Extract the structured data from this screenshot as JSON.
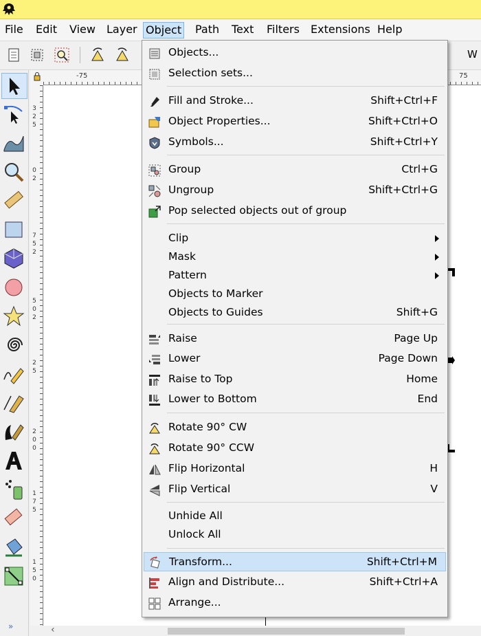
{
  "menubar": {
    "items": [
      "File",
      "Edit",
      "View",
      "Layer",
      "Object",
      "Path",
      "Text",
      "Filters",
      "Extensions",
      "Help"
    ],
    "active": "Object"
  },
  "toolbar": {
    "trailing_label": "W"
  },
  "rulers": {
    "top_labels": [
      "-75",
      "75"
    ],
    "left_labels": [
      "3",
      "2",
      "5",
      "0",
      "2",
      "7",
      "5",
      "2",
      "5",
      "0",
      "2",
      "2",
      "5",
      "2",
      "0",
      "0",
      "1",
      "7",
      "5",
      "1",
      "5",
      "0"
    ]
  },
  "object_menu": {
    "items": [
      {
        "icon": "objects-icon",
        "label": "Objects...",
        "shortcut": ""
      },
      {
        "icon": "selection-sets-icon",
        "label": "Selection sets...",
        "shortcut": ""
      },
      {
        "icon": "fill-and-stroke-icon",
        "label": "Fill and Stroke...",
        "shortcut": "Shift+Ctrl+F"
      },
      {
        "icon": "object-properties-icon",
        "label": "Object Properties...",
        "shortcut": "Shift+Ctrl+O"
      },
      {
        "icon": "symbols-icon",
        "label": "Symbols...",
        "shortcut": "Shift+Ctrl+Y"
      },
      {
        "icon": "group-icon",
        "label": "Group",
        "shortcut": "Ctrl+G"
      },
      {
        "icon": "ungroup-icon",
        "label": "Ungroup",
        "shortcut": "Shift+Ctrl+G"
      },
      {
        "icon": "pop-out-of-group-icon",
        "label": "Pop selected objects out of group",
        "shortcut": ""
      },
      {
        "icon": "",
        "label": "Clip",
        "shortcut": "",
        "submenu": true
      },
      {
        "icon": "",
        "label": "Mask",
        "shortcut": "",
        "submenu": true
      },
      {
        "icon": "",
        "label": "Pattern",
        "shortcut": "",
        "submenu": true
      },
      {
        "icon": "",
        "label": "Objects to Marker",
        "shortcut": ""
      },
      {
        "icon": "",
        "label": "Objects to Guides",
        "shortcut": "Shift+G"
      },
      {
        "icon": "raise-icon",
        "label": "Raise",
        "shortcut": "Page Up"
      },
      {
        "icon": "lower-icon",
        "label": "Lower",
        "shortcut": "Page Down"
      },
      {
        "icon": "raise-to-top-icon",
        "label": "Raise to Top",
        "shortcut": "Home"
      },
      {
        "icon": "lower-to-bottom-icon",
        "label": "Lower to Bottom",
        "shortcut": "End"
      },
      {
        "icon": "rotate-cw-icon",
        "label": "Rotate 90° CW",
        "shortcut": ""
      },
      {
        "icon": "rotate-ccw-icon",
        "label": "Rotate 90° CCW",
        "shortcut": ""
      },
      {
        "icon": "flip-horizontal-icon",
        "label": "Flip Horizontal",
        "shortcut": "H"
      },
      {
        "icon": "flip-vertical-icon",
        "label": "Flip Vertical",
        "shortcut": "V"
      },
      {
        "icon": "",
        "label": "Unhide All",
        "shortcut": ""
      },
      {
        "icon": "",
        "label": "Unlock All",
        "shortcut": ""
      },
      {
        "icon": "transform-icon",
        "label": "Transform...",
        "shortcut": "Shift+Ctrl+M",
        "highlighted": true
      },
      {
        "icon": "align-distribute-icon",
        "label": "Align and Distribute...",
        "shortcut": "Shift+Ctrl+A"
      },
      {
        "icon": "arrange-icon",
        "label": "Arrange...",
        "shortcut": ""
      }
    ]
  },
  "toolbox": {
    "tools": [
      "selector-tool-icon",
      "node-tool-icon",
      "tweak-tool-icon",
      "zoom-tool-icon",
      "measure-tool-icon",
      "rectangle-tool-icon",
      "3d-box-tool-icon",
      "ellipse-tool-icon",
      "star-tool-icon",
      "spiral-tool-icon",
      "pencil-tool-icon",
      "pen-tool-icon",
      "calligraphy-tool-icon",
      "text-tool-icon",
      "spray-tool-icon",
      "eraser-tool-icon",
      "paint-bucket-tool-icon",
      "gradient-tool-icon"
    ],
    "more_label": "»"
  },
  "colors": {
    "titlebar": "#fdf27a",
    "menu_highlight": "#cde4f8",
    "canvas": "#ffffff"
  }
}
